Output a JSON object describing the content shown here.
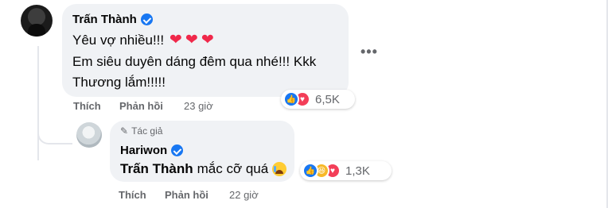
{
  "comment": {
    "author": "Trấn Thành",
    "lines": [
      "Yêu vợ nhiều!!!",
      "Em siêu duyên dáng đêm qua nhé!!! Kkk",
      "Thương lắm!!!!!"
    ],
    "hearts": [
      "❤",
      "❤",
      "❤"
    ],
    "actions": {
      "like": "Thích",
      "reply": "Phản hồi",
      "time": "23 giờ"
    },
    "reactions": {
      "icons": [
        "like-icon",
        "love-icon"
      ],
      "count": "6,5K"
    },
    "more": "•••"
  },
  "reply": {
    "tag_icon": "pencil-icon",
    "tag": "Tác giả",
    "author": "Hariwon",
    "mention": "Trấn Thành",
    "text": "mắc cỡ quá",
    "emoji": "crying-emoji",
    "actions": {
      "like": "Thích",
      "reply": "Phản hồi",
      "time": "22 giờ"
    },
    "reactions": {
      "icons": [
        "like-icon",
        "haha-icon",
        "love-icon"
      ],
      "count": "1,3K"
    }
  },
  "colors": {
    "bubble": "#f0f2f5",
    "verified": "#1877f2",
    "meta": "#65676b",
    "heart": "#f0284a"
  }
}
